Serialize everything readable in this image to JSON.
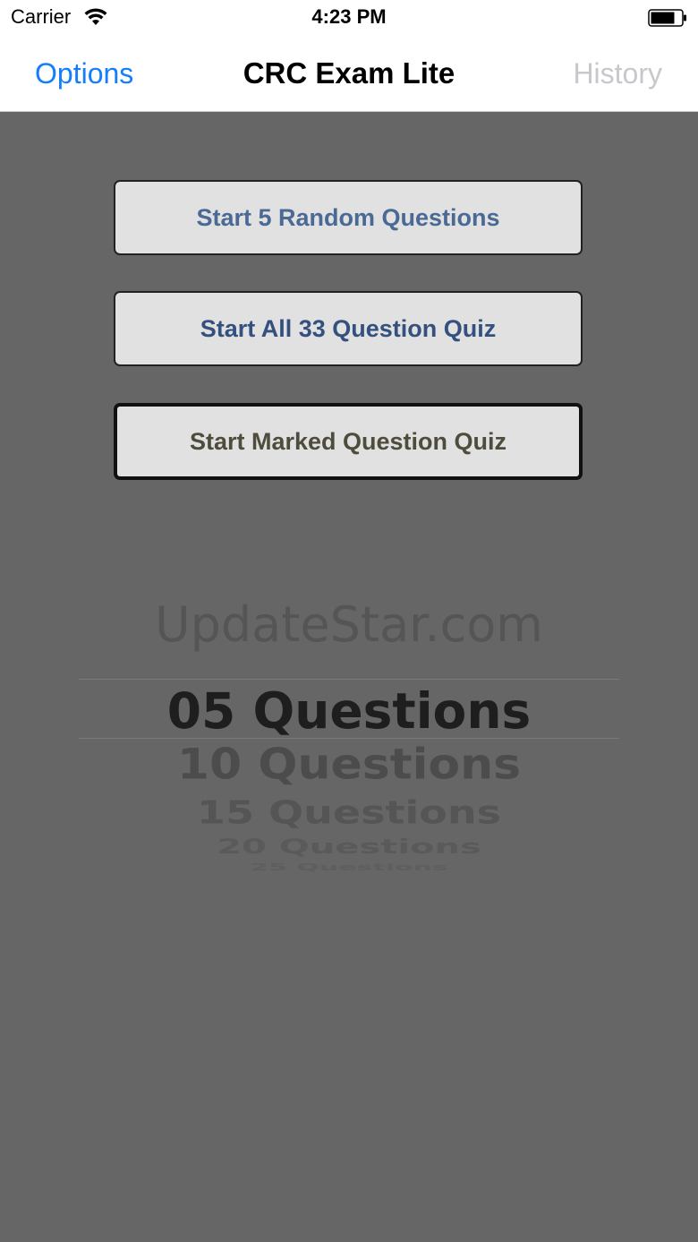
{
  "status_bar": {
    "carrier": "Carrier",
    "time": "4:23 PM",
    "wifi_icon": "wifi-icon",
    "battery_icon": "battery-icon"
  },
  "nav": {
    "left_label": "Options",
    "title": "CRC Exam Lite",
    "right_label": "History",
    "accent_color": "#147efb",
    "disabled_color": "#c8c8cc"
  },
  "buttons": {
    "random": "Start 5 Random Questions",
    "all": "Start All 33 Question Quiz",
    "marked": "Start Marked Question Quiz"
  },
  "watermark": "UpdateStar.com",
  "picker": {
    "options": [
      "05 Questions",
      "10 Questions",
      "15 Questions",
      "20 Questions",
      "25 Questions"
    ],
    "selected": "05 Questions"
  },
  "colors": {
    "background": "#666666",
    "button_fill": "#e1e1e1"
  }
}
